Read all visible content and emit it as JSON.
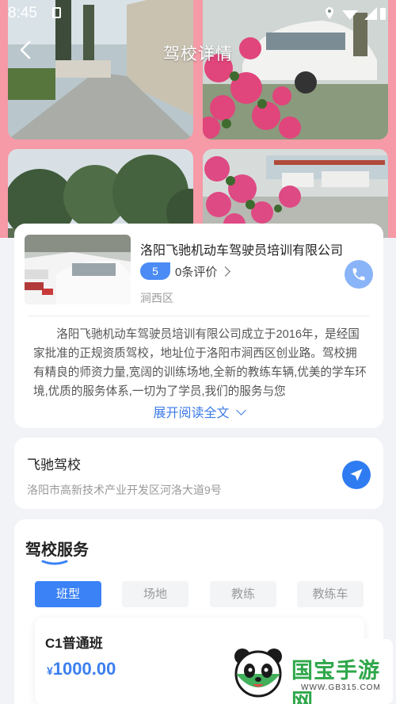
{
  "status_bar": {
    "time": "8:45"
  },
  "header": {
    "title": "驾校详情"
  },
  "school": {
    "name": "洛阳飞驰机动车驾驶员培训有限公司",
    "score": "5",
    "reviews": "0条评价",
    "district": "涧西区",
    "intro": "洛阳飞驰机动车驾驶员培训有限公司成立于2016年，是经国家批准的正规资质驾校，地址位于洛阳市涧西区创业路。驾校拥有精良的师资力量,宽阔的训练场地,全新的教练车辆,优美的学车环境,优质的服务体系,一切为了学员,我们的服务与您",
    "expand_label": "展开阅读全文"
  },
  "location": {
    "name": "飞驰驾校",
    "address": "洛阳市高新技术产业开发区河洛大道9号"
  },
  "services": {
    "title": "驾校服务",
    "tabs": [
      {
        "label": "班型",
        "active": true
      },
      {
        "label": "场地",
        "active": false
      },
      {
        "label": "教练",
        "active": false
      },
      {
        "label": "教练车",
        "active": false
      }
    ],
    "classes": [
      {
        "name": "C1普通班",
        "currency": "¥",
        "price": "1000.00"
      }
    ]
  },
  "watermark": {
    "brand": "国宝手游网",
    "url": "WWW.GB315.COM"
  },
  "colors": {
    "accent": "#3b82f6",
    "hero_bg": "#f59aa6",
    "price": "#3b7ff0"
  }
}
